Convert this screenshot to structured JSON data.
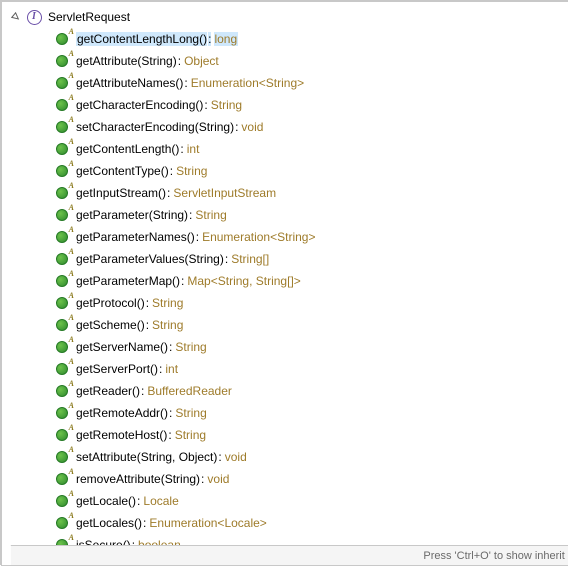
{
  "class": {
    "name": "ServletRequest"
  },
  "methods": [
    {
      "sig": "getContentLengthLong()",
      "ret": "long",
      "selected": true
    },
    {
      "sig": "getAttribute(String)",
      "ret": "Object"
    },
    {
      "sig": "getAttributeNames()",
      "ret": "Enumeration<String>"
    },
    {
      "sig": "getCharacterEncoding()",
      "ret": "String"
    },
    {
      "sig": "setCharacterEncoding(String)",
      "ret": "void"
    },
    {
      "sig": "getContentLength()",
      "ret": "int"
    },
    {
      "sig": "getContentType()",
      "ret": "String"
    },
    {
      "sig": "getInputStream()",
      "ret": "ServletInputStream"
    },
    {
      "sig": "getParameter(String)",
      "ret": "String"
    },
    {
      "sig": "getParameterNames()",
      "ret": "Enumeration<String>"
    },
    {
      "sig": "getParameterValues(String)",
      "ret": "String[]"
    },
    {
      "sig": "getParameterMap()",
      "ret": "Map<String, String[]>"
    },
    {
      "sig": "getProtocol()",
      "ret": "String"
    },
    {
      "sig": "getScheme()",
      "ret": "String"
    },
    {
      "sig": "getServerName()",
      "ret": "String"
    },
    {
      "sig": "getServerPort()",
      "ret": "int"
    },
    {
      "sig": "getReader()",
      "ret": "BufferedReader"
    },
    {
      "sig": "getRemoteAddr()",
      "ret": "String"
    },
    {
      "sig": "getRemoteHost()",
      "ret": "String"
    },
    {
      "sig": "setAttribute(String, Object)",
      "ret": "void"
    },
    {
      "sig": "removeAttribute(String)",
      "ret": "void"
    },
    {
      "sig": "getLocale()",
      "ret": "Locale"
    },
    {
      "sig": "getLocales()",
      "ret": "Enumeration<Locale>"
    },
    {
      "sig": "isSecure()",
      "ret": "boolean"
    }
  ],
  "status": {
    "hint": "Press 'Ctrl+O' to show inherit"
  }
}
